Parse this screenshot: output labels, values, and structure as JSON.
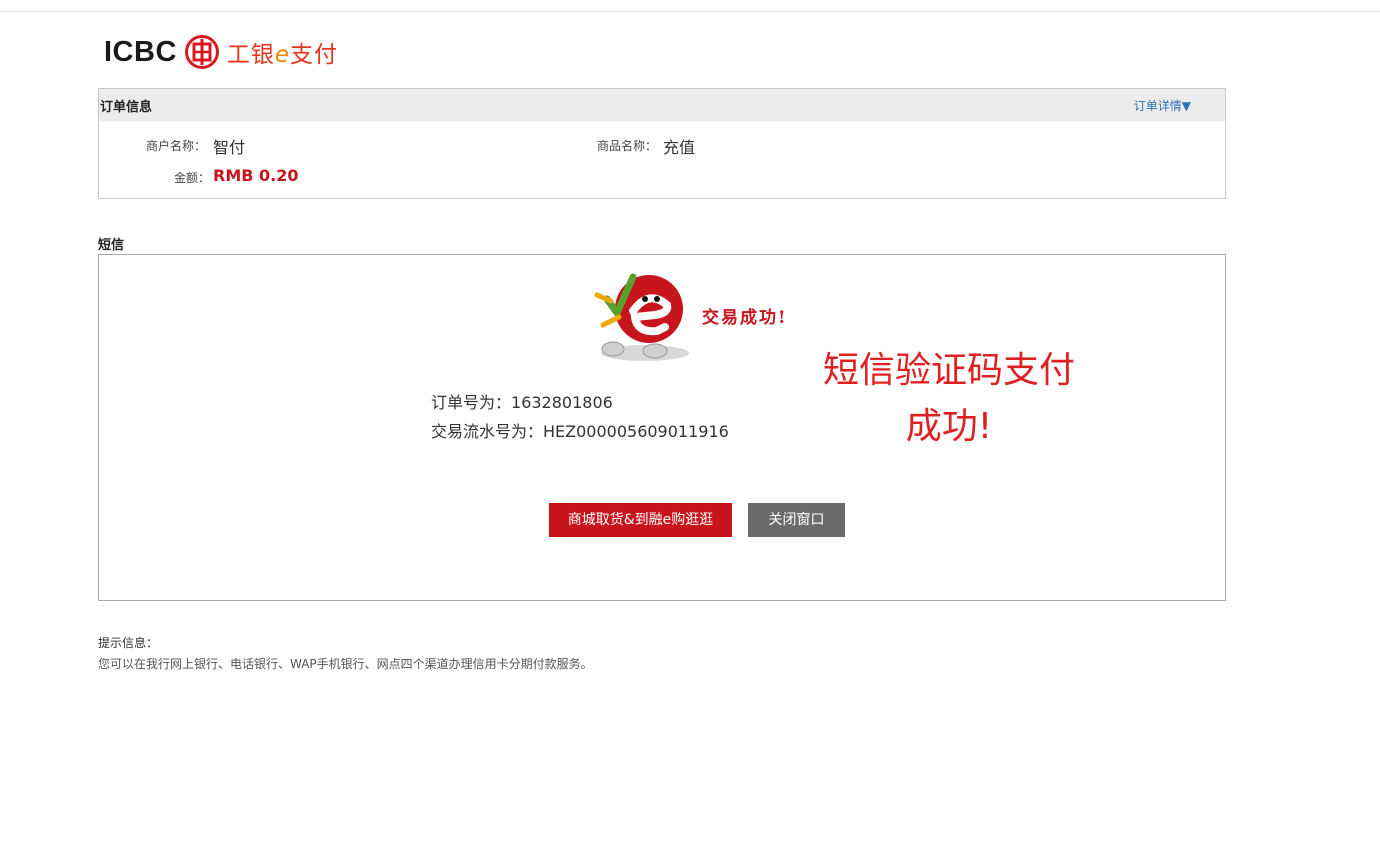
{
  "brand": {
    "name": "ICBC",
    "product_prefix": "工银",
    "product_e": "e",
    "product_suffix": "支付",
    "accent": "#c8141c"
  },
  "order": {
    "title": "订单信息",
    "detail_link": "订单详情▼",
    "merchant_label": "商户名称：",
    "merchant_value": "智付",
    "product_label": "商品名称：",
    "product_value": "充值",
    "amount_label": "金额：",
    "amount_value": "RMB 0.20"
  },
  "sms": {
    "label": "短信",
    "success_small": "交易成功!",
    "annotation_line1": "短信验证码支付",
    "annotation_line2": "成功!",
    "order_no_label": "订单号为：",
    "order_no": "1632801806",
    "txn_label": "交易流水号为：",
    "txn_no": "HEZ000005609011916",
    "primary_button": "商城取货&到融e购逛逛",
    "close_button": "关闭窗口"
  },
  "tips": {
    "title": "提示信息：",
    "text": "您可以在我行网上银行、电话银行、WAP手机银行、网点四个渠道办理信用卡分期付款服务。"
  }
}
